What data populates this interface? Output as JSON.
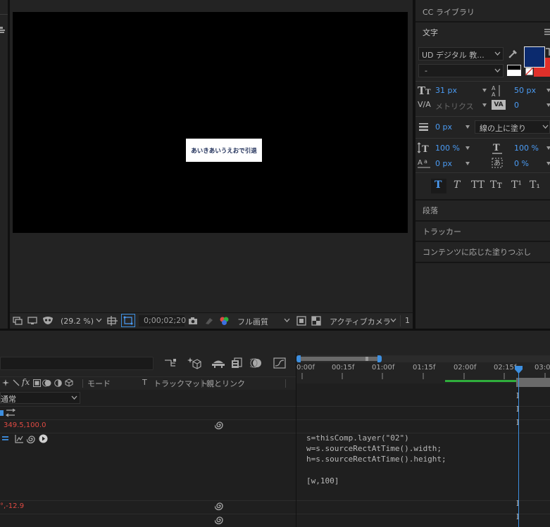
{
  "comp": {
    "text_box": "あいきあいうえおで引退",
    "zoom": "(29.2 %)",
    "timecode": "0;00;02;20",
    "quality": "フル画質",
    "camera": "アクティブカメラ",
    "views": "1"
  },
  "panels": {
    "cc_libraries": "CC ライブラリ",
    "character": "文字",
    "paragraph": "段落",
    "tracker": "トラッカー",
    "content_aware_fill": "コンテンツに応じた塗りつぶし"
  },
  "character": {
    "font_family": "UD デジタル 教...",
    "font_style": "-",
    "font_size": "31 px",
    "leading": "50 px",
    "kerning": "メトリクス",
    "tracking": "0",
    "stroke_width": "0 px",
    "stroke_option": "線の上に塗り",
    "vertical_scale": "100 %",
    "horizontal_scale": "100 %",
    "baseline_shift": "0 px",
    "tsume": "0 %",
    "fill_color": "#0b2a6e",
    "stroke_color": "#e0302a",
    "style_buttons": [
      "T",
      "T",
      "TT",
      "Tт",
      "T¹",
      "T₁"
    ]
  },
  "timeline": {
    "columns": {
      "mode": "モード",
      "t": "T",
      "track_matte": "トラックマット",
      "parent_link": "親とリンク"
    },
    "ruler": [
      "0:00f",
      "00:15f",
      "01:00f",
      "01:15f",
      "02:00f",
      "02:15f",
      "03:0"
    ],
    "mode_value": "通常",
    "value_1": "349.5,100.0",
    "value_2": "°,-12.9"
  },
  "expression": {
    "line1": "s=thisComp.layer(\"02\")",
    "line2": "w=s.sourceRectAtTime().width;",
    "line3": "h=s.sourceRectAtTime().height;",
    "line4": "[w,100]"
  },
  "colors": {
    "accent": "#3d8fe0",
    "work_area": "#2fae3c",
    "value_red": "#e04a43"
  }
}
